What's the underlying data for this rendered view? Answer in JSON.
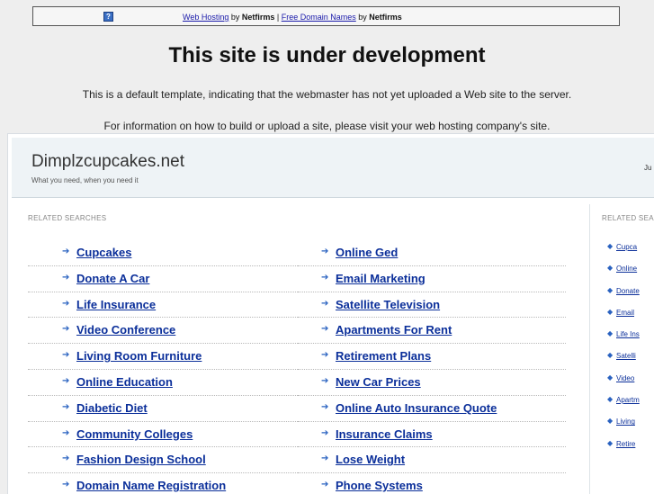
{
  "topbar": {
    "icon": "question-icon",
    "link1": "Web Hosting",
    "by1": " by ",
    "brand1": "Netfirms",
    "sep": " | ",
    "link2": "Free Domain Names",
    "by2": " by ",
    "brand2": "Netfirms"
  },
  "heading": "This site is under development",
  "message1": "This is a default template, indicating that the webmaster has not yet uploaded a Web site to the server.",
  "message2": "For information on how to build or upload a site, please visit your web hosting company's site.",
  "parked": {
    "domain": "Dimplzcupcakes.net",
    "tagline": "What you need, when you need it",
    "right_text": "Ju",
    "related_title": "RELATED SEARCHES",
    "related_title_right": "RELATED SEA",
    "col1": [
      "Cupcakes",
      "Donate A Car",
      "Life Insurance",
      "Video Conference",
      "Living Room Furniture",
      "Online Education",
      "Diabetic Diet",
      "Community Colleges",
      "Fashion Design School",
      "Domain Name Registration"
    ],
    "col2": [
      "Online Ged",
      "Email Marketing",
      "Satellite Television",
      "Apartments For Rent",
      "Retirement Plans",
      "New Car Prices",
      "Online Auto Insurance Quote",
      "Insurance Claims",
      "Lose Weight",
      "Phone Systems"
    ],
    "side": [
      "Cupca",
      "Online",
      "Donate",
      "Email",
      "Life Ins",
      "Satelli",
      "Video",
      "Apartm",
      "Living",
      "Retire"
    ]
  },
  "colors": {
    "link": "#0b2f9a",
    "arrow": "#2a62c0",
    "header_bg": "#eef3f6",
    "page_bg": "#eeeeee"
  }
}
